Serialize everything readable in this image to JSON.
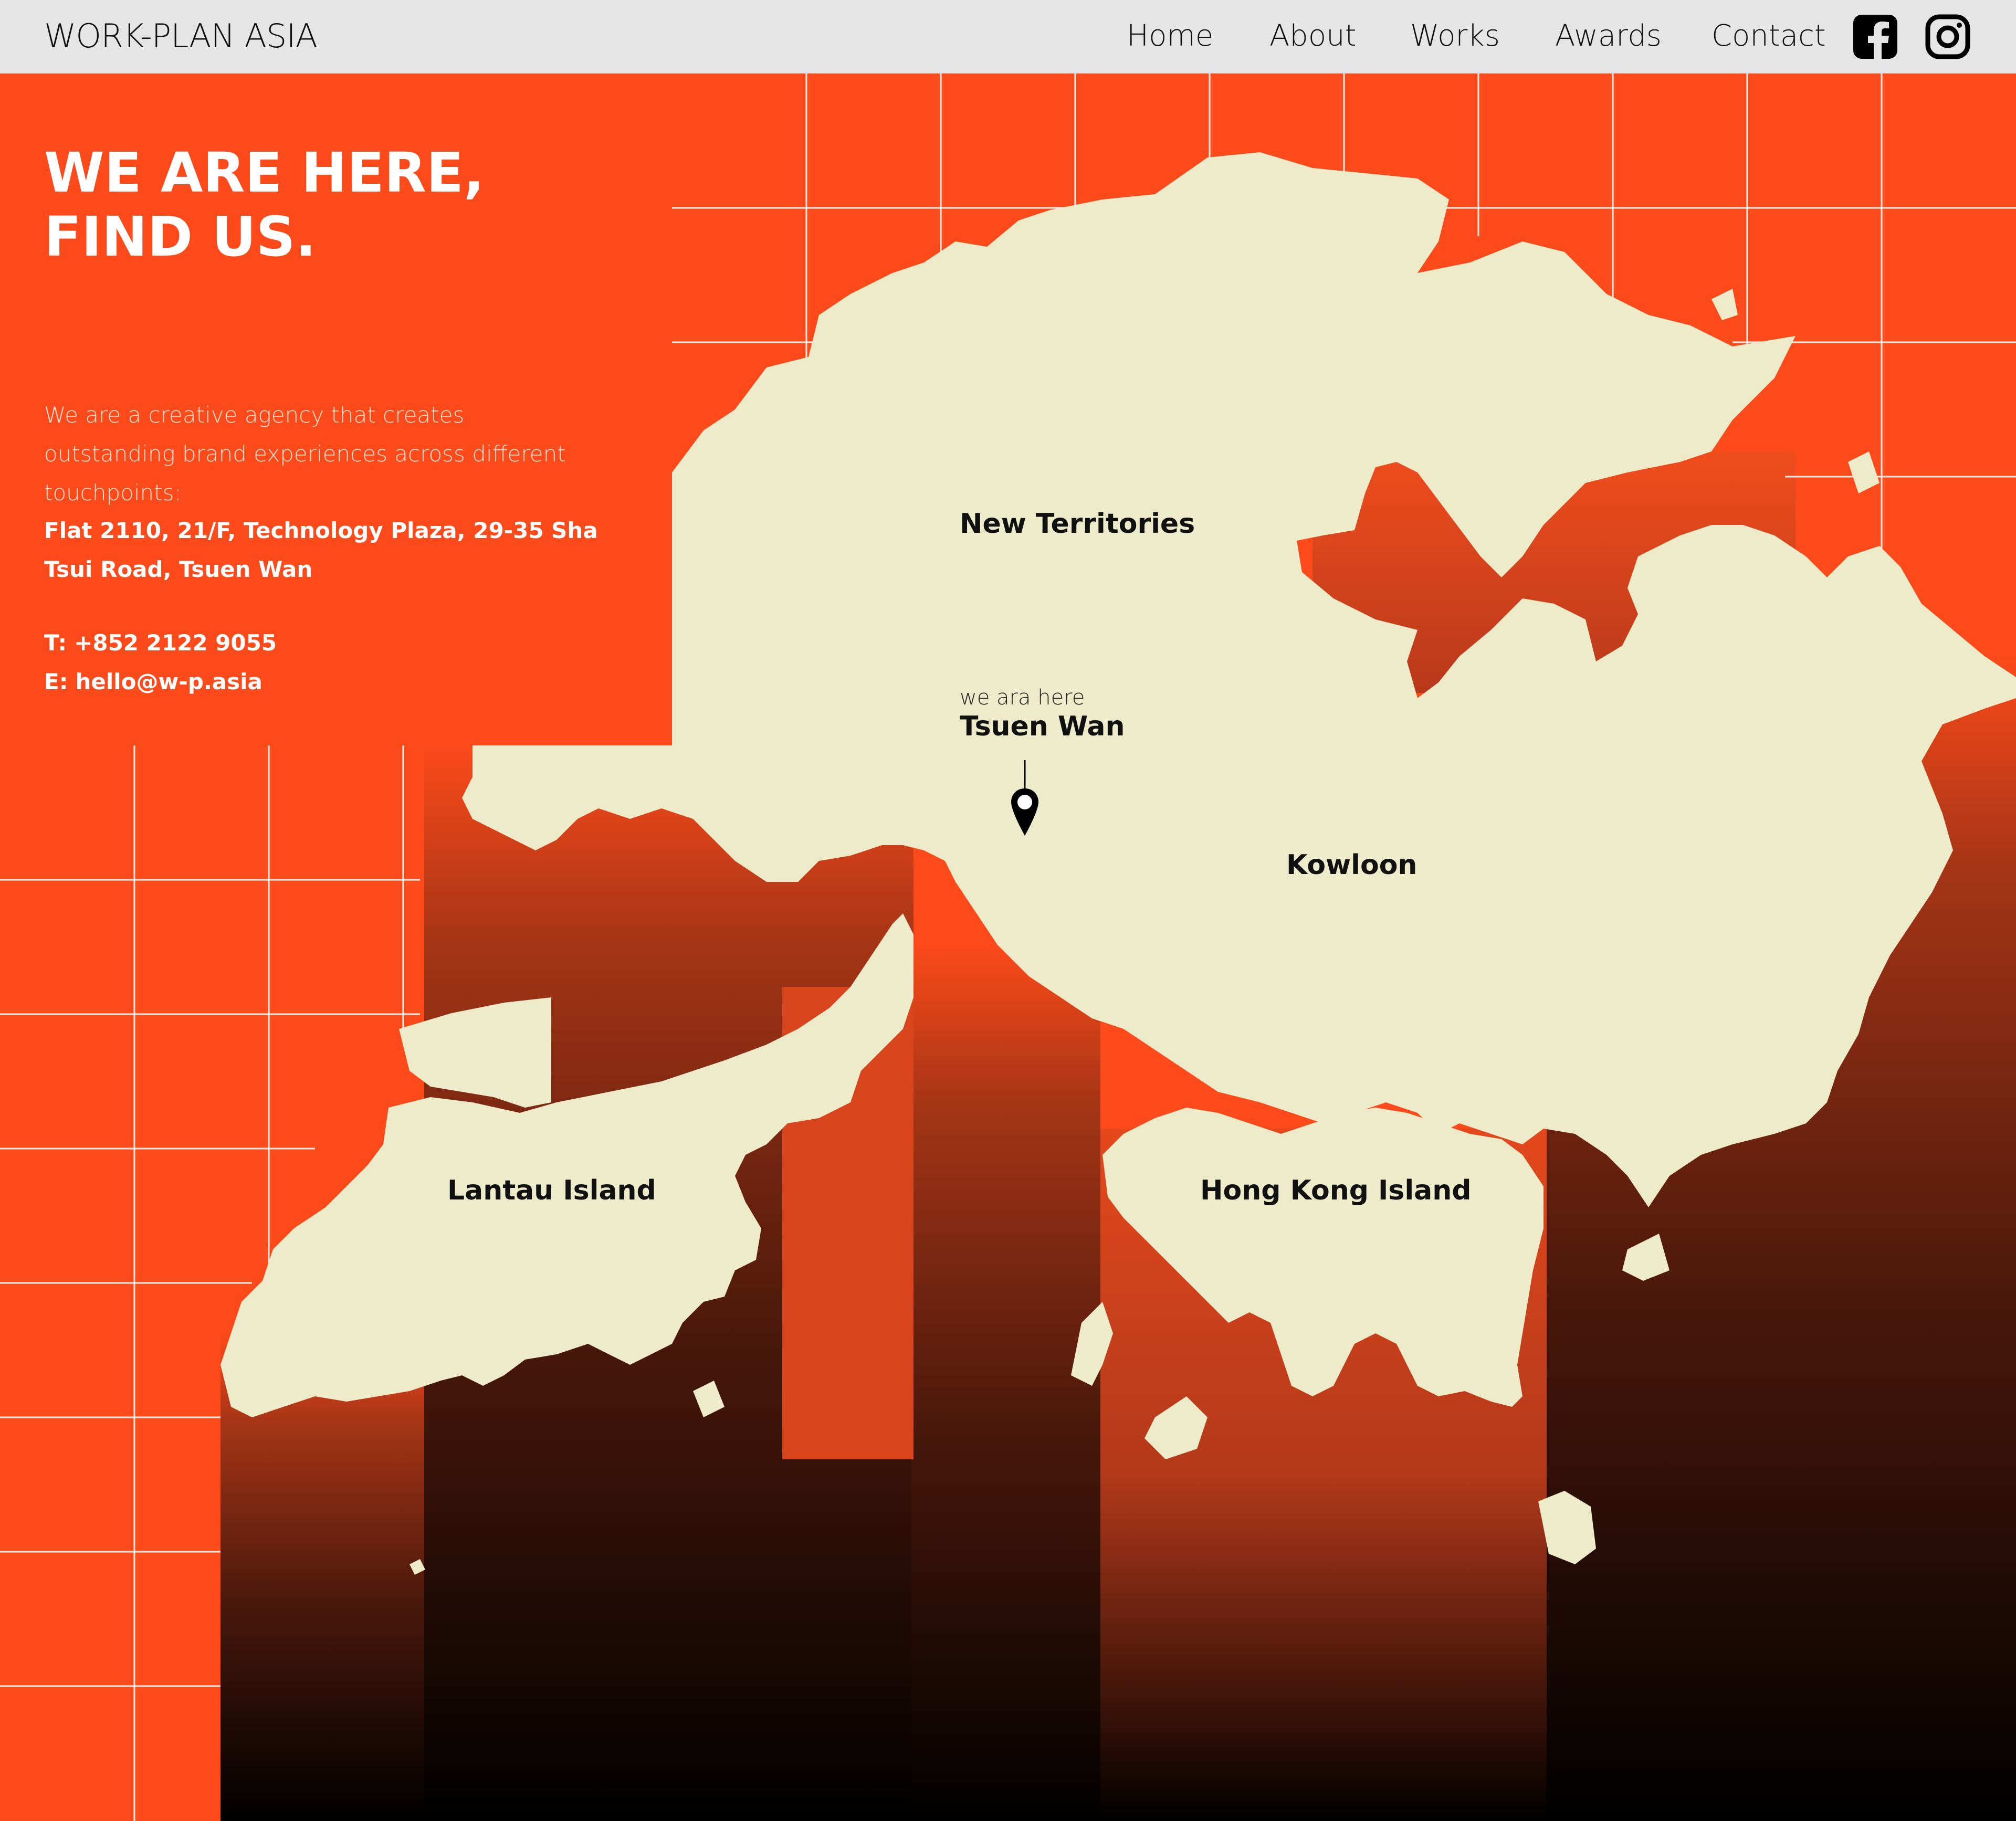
{
  "header": {
    "brand": "WORK-PLAN ASIA",
    "nav": [
      "Home",
      "About",
      "Works",
      "Awards",
      "Contact"
    ],
    "social_icons": [
      "facebook-icon",
      "instagram-icon"
    ]
  },
  "panel": {
    "headline": "WE ARE HERE,\nFIND US.",
    "intro": "We are a creative agency that creates outstanding brand experiences across different touchpoints:",
    "address": "Flat 2110, 21/F, Technology Plaza, 29-35 Sha Tsui Road, Tsuen Wan",
    "phone_label": "T:",
    "phone": "+852 2122 9055",
    "email_label": "E:",
    "email": "hello@w-p.asia"
  },
  "map": {
    "regions": [
      "New Territories",
      "Kowloon",
      "Lantau Island",
      "Hong Kong Island"
    ],
    "marker_caption": "we ara here",
    "marker_place": "Tsuen Wan",
    "colors": {
      "land": "#EEEBCB",
      "sea_orange": "#FC4A1A",
      "sea_dark": "#000000",
      "grid": "#FFFFFF"
    }
  }
}
